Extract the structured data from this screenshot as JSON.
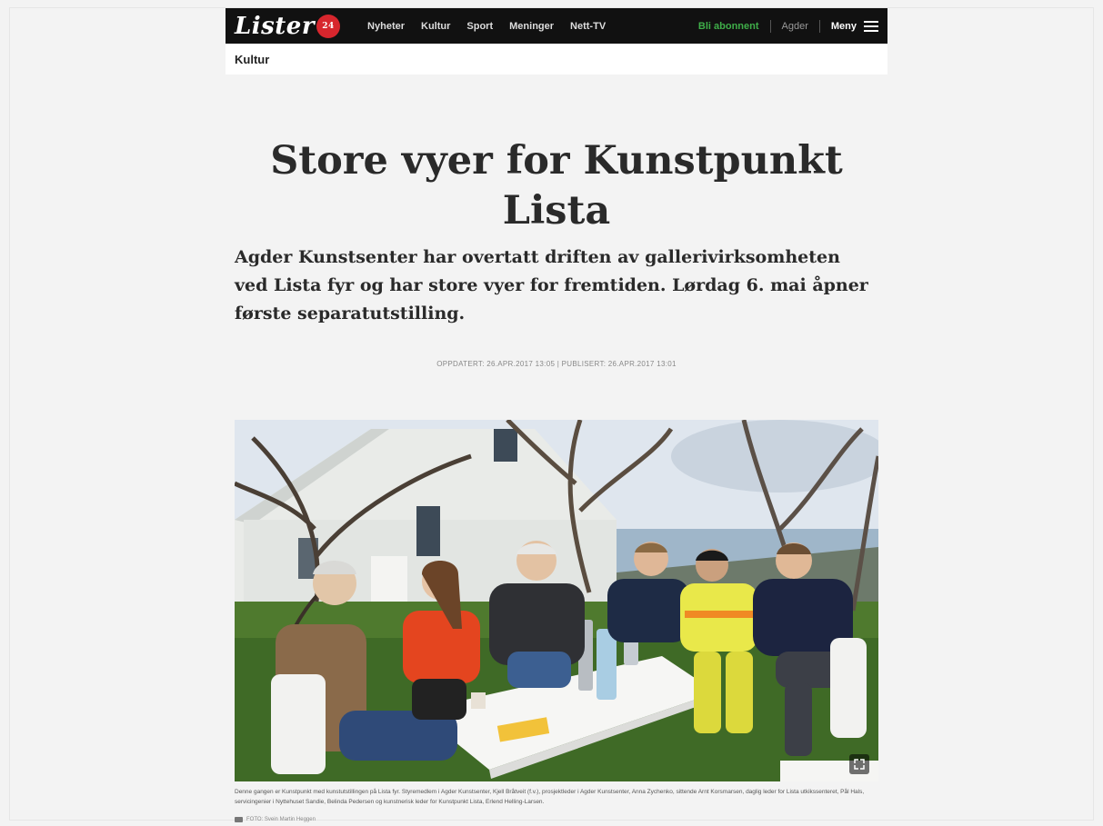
{
  "header": {
    "logo_text": "Lister",
    "logo_badge": "24",
    "nav": [
      "Nyheter",
      "Kultur",
      "Sport",
      "Meninger",
      "Nett-TV"
    ],
    "subscribe_label": "Bli abonnent",
    "region_label": "Agder",
    "menu_label": "Meny"
  },
  "section": {
    "label": "Kultur"
  },
  "article": {
    "headline": "Store vyer for Kunstpunkt Lista",
    "lead": "Agder Kunstsenter har overtatt driften av gallerivirksomheten ved Lista fyr og har store vyer for fremtiden. Lørdag 6. mai åpner første separatutstilling.",
    "meta": "OPPDATERT: 26.APR.2017 13:05 | PUBLISERT: 26.APR.2017 13:01",
    "caption": "Denne gangen er Kunstpunkt med kunstutstillingen på Lista fyr. Styremedlem i Agder Kunstsenter, Kjell Bråtveit (f.v.), prosjektleder i Agder Kunstsenter, Anna Zychenko, sittende Arnt Korsmarsen, daglig leder for Lista utkikssenteret, Pål Hals, servicingenier i Nyttehuset Sandie, Belinda Pedersen og kunstnerisk leder for Kunstpunkt Lista, Erlend Helling-Larsen.",
    "credit": "FOTO: Svein Martin Heggen"
  },
  "colors": {
    "header_bg": "#111111",
    "subscribe": "#3fae49",
    "badge": "#d7262d",
    "page_bg": "#f3f3f3"
  }
}
